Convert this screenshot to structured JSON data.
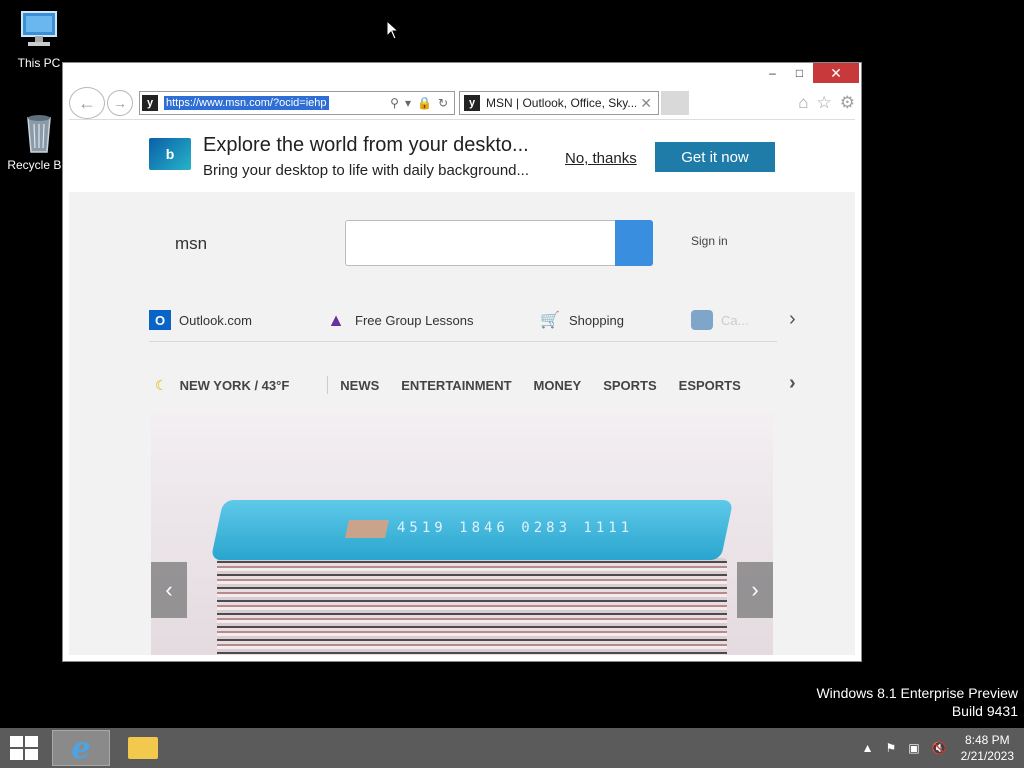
{
  "desktop": {
    "icons": [
      {
        "label": "This PC"
      },
      {
        "label": "Recycle Bin"
      }
    ],
    "watermark": {
      "line1": "Windows 8.1 Enterprise Preview",
      "line2": "Build 9431"
    }
  },
  "window": {
    "controls": {
      "minimize": "–",
      "maximize": "□",
      "close": "✕"
    }
  },
  "browser": {
    "address": "https://www.msn.com/?ocid=iehp",
    "tab_title": "MSN | Outlook, Office, Sky...",
    "favicon_letter": "y"
  },
  "banner": {
    "title": "Explore the world from your deskto...",
    "subtitle": "Bring your desktop to life with daily background...",
    "logo_letter": "b",
    "dismiss_label": "No, thanks",
    "cta_label": "Get it now"
  },
  "msn": {
    "logo": "msn",
    "sign_in": "Sign in",
    "search_placeholder": "",
    "quick_links": [
      {
        "label": "Outlook.com"
      },
      {
        "label": "Free Group Lessons"
      },
      {
        "label": "Shopping"
      },
      {
        "label": "Ca..."
      }
    ],
    "weather": "NEW YORK / 43°F",
    "nav": [
      "NEWS",
      "ENTERTAINMENT",
      "MONEY",
      "SPORTS",
      "ESPORTS"
    ],
    "hero_card_number": "4519 1846 0283 1111"
  },
  "taskbar": {
    "time": "8:48 PM",
    "date": "2/21/2023"
  }
}
